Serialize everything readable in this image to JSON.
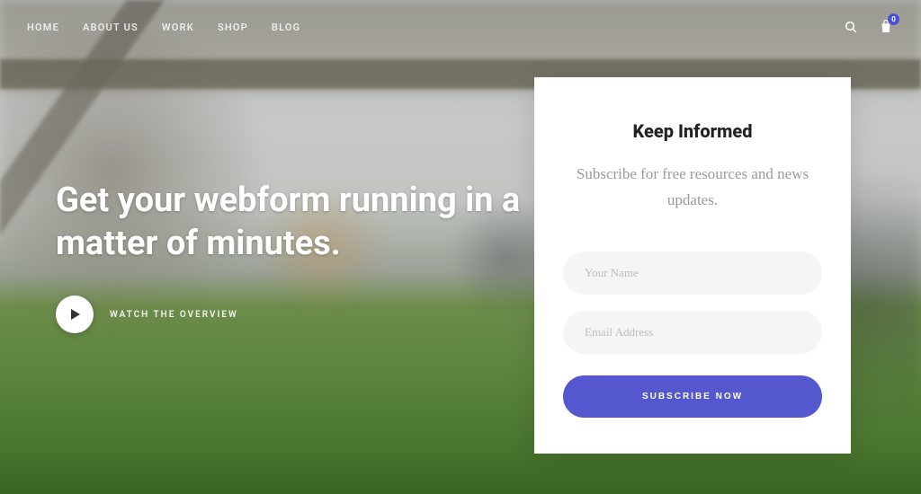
{
  "nav": {
    "items": [
      "HOME",
      "ABOUT US",
      "WORK",
      "SHOP",
      "BLOG"
    ],
    "cart_count": "0"
  },
  "hero": {
    "title": "Get your webform running in a matter of minutes.",
    "watch_label": "WATCH THE OVERVIEW"
  },
  "form": {
    "title": "Keep Informed",
    "subtitle": "Subscribe for free resources and news updates.",
    "name_placeholder": "Your Name",
    "email_placeholder": "Email Address",
    "button_label": "SUBSCRIBE NOW"
  },
  "colors": {
    "accent": "#5557cf"
  }
}
